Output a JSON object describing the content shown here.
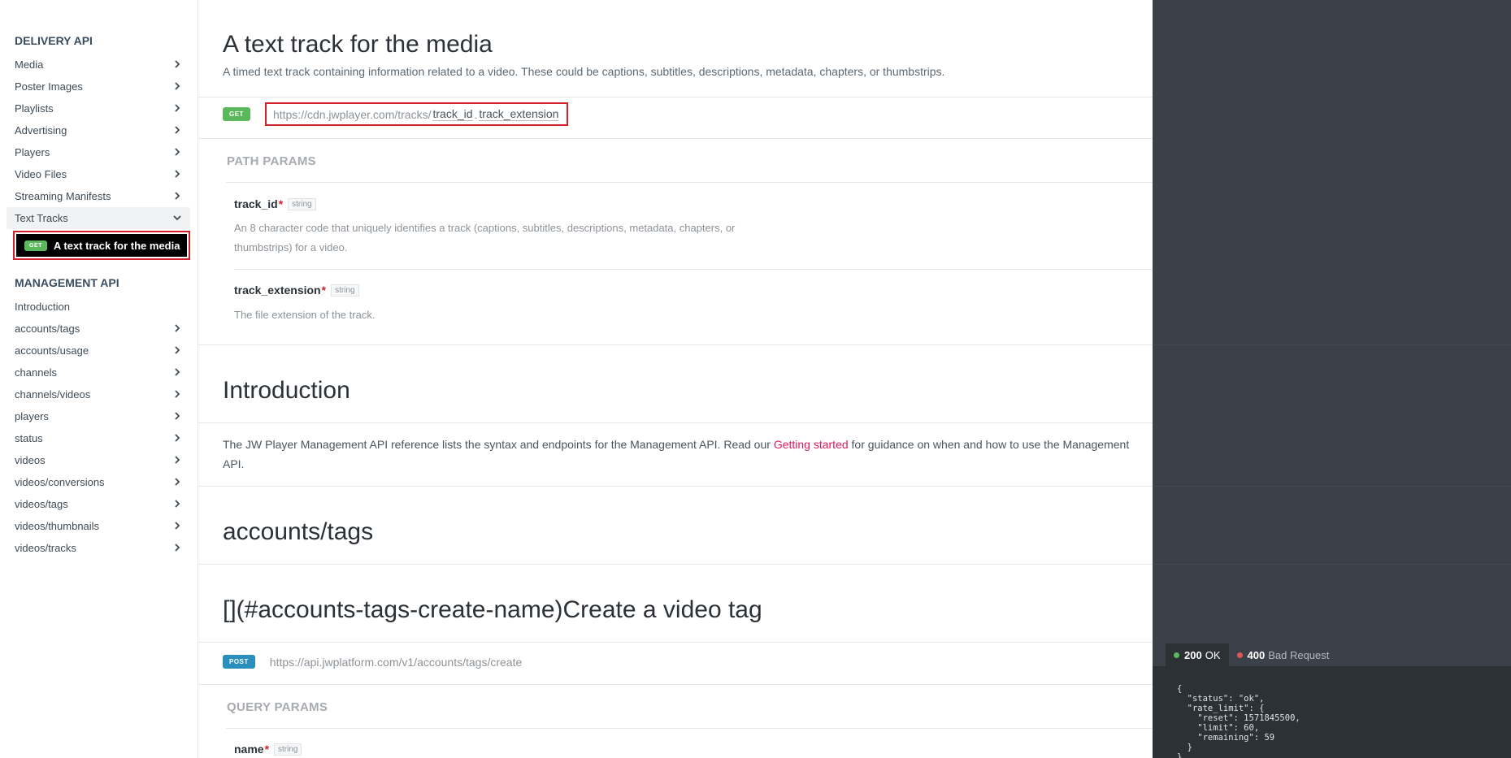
{
  "sidebar": {
    "delivery_title": "DELIVERY API",
    "delivery_items": [
      {
        "label": "Media"
      },
      {
        "label": "Poster Images"
      },
      {
        "label": "Playlists"
      },
      {
        "label": "Advertising"
      },
      {
        "label": "Players"
      },
      {
        "label": "Video Files"
      },
      {
        "label": "Streaming Manifests"
      },
      {
        "label": "Text Tracks"
      }
    ],
    "active_item": {
      "method": "GET",
      "label": "A text track for the media"
    },
    "management_title": "MANAGEMENT API",
    "management_items": [
      {
        "label": "Introduction"
      },
      {
        "label": "accounts/tags"
      },
      {
        "label": "accounts/usage"
      },
      {
        "label": "channels"
      },
      {
        "label": "channels/videos"
      },
      {
        "label": "players"
      },
      {
        "label": "status"
      },
      {
        "label": "videos"
      },
      {
        "label": "videos/conversions"
      },
      {
        "label": "videos/tags"
      },
      {
        "label": "videos/thumbnails"
      },
      {
        "label": "videos/tracks"
      }
    ]
  },
  "main": {
    "track_section": {
      "title": "A text track for the media",
      "description": "A timed text track containing information related to a video. These could be captions, subtitles, descriptions, metadata, chapters, or thumbstrips.",
      "method": "GET",
      "url_base": "https://cdn.jwplayer.com/tracks/",
      "url_param1": "track_id",
      "url_dot": ".",
      "url_param2": "track_extension",
      "params_label": "PATH PARAMS",
      "params": [
        {
          "name": "track_id",
          "required": "*",
          "type": "string",
          "description": "An 8 character code that uniquely identifies a track (captions, subtitles, descriptions, metadata, chapters, or thumbstrips) for a video."
        },
        {
          "name": "track_extension",
          "required": "*",
          "type": "string",
          "description": "The file extension of the track."
        }
      ]
    },
    "intro": {
      "title": "Introduction",
      "text_before": "The JW Player Management API reference lists the syntax and endpoints for the Management API. Read our ",
      "link": "Getting started",
      "text_after": " for guidance on when and how to use the Management API."
    },
    "accounts_tags_title": "accounts/tags",
    "create_tag": {
      "title": "[](#accounts-tags-create-name)Create a video tag",
      "method": "POST",
      "url": "https://api.jwplatform.com/v1/accounts/tags/create",
      "params_label": "QUERY PARAMS",
      "param": {
        "name": "name",
        "required": "*",
        "type": "string"
      }
    }
  },
  "response": {
    "tabs": [
      {
        "code": "200",
        "label": "OK",
        "color": "#5cb85c"
      },
      {
        "code": "400",
        "label": "Bad Request",
        "color": "#e05656"
      }
    ],
    "body": "{\n  \"status\": \"ok\",\n  \"rate_limit\": {\n    \"reset\": 1571845500,\n    \"limit\": 60,\n    \"remaining\": 59\n  }\n}"
  }
}
